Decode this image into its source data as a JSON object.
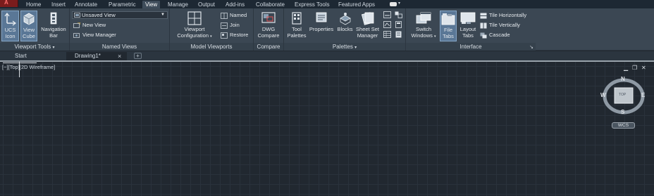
{
  "menu": {
    "tabs": [
      "Home",
      "Insert",
      "Annotate",
      "Parametric",
      "View",
      "Manage",
      "Output",
      "Add-ins",
      "Collaborate",
      "Express Tools",
      "Featured Apps"
    ],
    "active": "View"
  },
  "ribbon": {
    "viewport_tools": {
      "title": "Viewport Tools",
      "ucs_icon": "UCS\nIcon",
      "view_cube": "View\nCube",
      "navigation_bar": "Navigation\nBar"
    },
    "named_views": {
      "title": "Named Views",
      "dropdown_value": "Unsaved View",
      "new_view": "New View",
      "view_manager": "View Manager"
    },
    "model_viewports": {
      "title": "Model Viewports",
      "viewport_configuration": "Viewport\nConfiguration",
      "named": "Named",
      "join": "Join",
      "restore": "Restore"
    },
    "compare": {
      "title": "Compare",
      "dwg_compare": "DWG\nCompare"
    },
    "palettes": {
      "title": "Palettes",
      "tool_palettes": "Tool\nPalettes",
      "properties": "Properties",
      "blocks": "Blocks",
      "sheet_set_manager": "Sheet Set\nManager"
    },
    "interface": {
      "title": "Interface",
      "switch_windows": "Switch\nWindows",
      "file_tabs": "File\nTabs",
      "layout_tabs": "Layout\nTabs",
      "tile_horizontally": "Tile Horizontally",
      "tile_vertically": "Tile Vertically",
      "cascade": "Cascade"
    }
  },
  "file_tabs": {
    "start": "Start",
    "drawing": "Drawing1*"
  },
  "viewport": {
    "label": "[−][Top][2D Wireframe]"
  },
  "viewcube": {
    "north": "N",
    "south": "S",
    "east": "E",
    "west": "W",
    "face": "TOP",
    "wcs": "WCS"
  },
  "colors": {
    "background": "#212830",
    "ribbon": "#3b4753",
    "active_button": "#5a7796"
  }
}
